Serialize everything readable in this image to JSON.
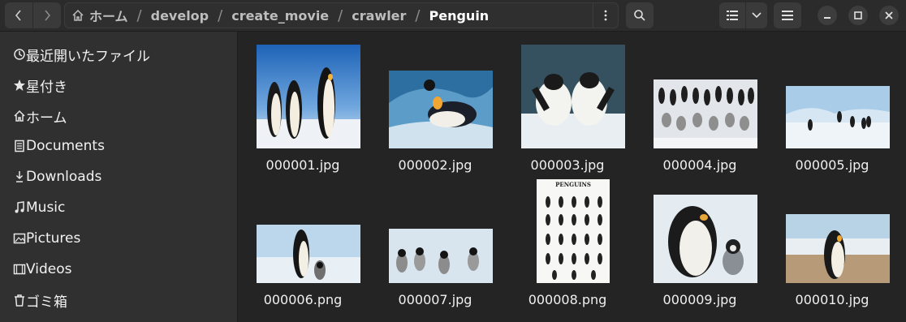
{
  "path": {
    "home_label": "ホーム",
    "segments": [
      "develop",
      "create_movie",
      "crawler"
    ],
    "current": "Penguin",
    "separator": "/"
  },
  "icons": {
    "back": "chevron-left-icon",
    "forward": "chevron-right-icon",
    "home": "home-icon",
    "path_menu": "kebab-menu-icon",
    "search": "search-icon",
    "view_list": "list-view-icon",
    "view_dropdown": "chevron-down-icon",
    "main_menu": "hamburger-menu-icon",
    "minimize": "minimize-icon",
    "maximize": "maximize-icon",
    "close": "close-icon"
  },
  "sidebar": {
    "items": [
      {
        "label": "最近開いたファイル",
        "icon": "recent-icon"
      },
      {
        "label": "星付き",
        "icon": "star-icon"
      },
      {
        "label": "ホーム",
        "icon": "home-icon"
      },
      {
        "label": "Documents",
        "icon": "document-icon"
      },
      {
        "label": "Downloads",
        "icon": "download-icon"
      },
      {
        "label": "Music",
        "icon": "music-icon"
      },
      {
        "label": "Pictures",
        "icon": "picture-icon"
      },
      {
        "label": "Videos",
        "icon": "video-icon"
      },
      {
        "label": "ゴミ箱",
        "icon": "trash-icon"
      }
    ]
  },
  "files": [
    {
      "name": "000001.jpg"
    },
    {
      "name": "000002.jpg"
    },
    {
      "name": "000003.jpg"
    },
    {
      "name": "000004.jpg"
    },
    {
      "name": "000005.jpg"
    },
    {
      "name": "000006.png"
    },
    {
      "name": "000007.jpg"
    },
    {
      "name": "000008.png",
      "poster_title": "PENGUINS"
    },
    {
      "name": "000009.jpg"
    },
    {
      "name": "000010.jpg"
    }
  ],
  "colors": {
    "window_bg": "#242424",
    "sidebar_bg": "#303030",
    "headerbar_bg": "#2b2b2b"
  }
}
